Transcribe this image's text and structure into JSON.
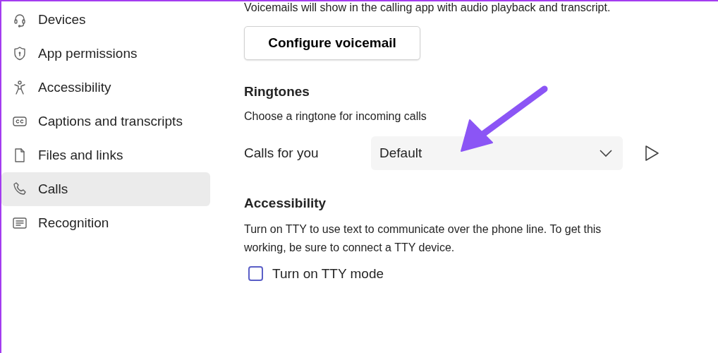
{
  "sidebar": {
    "items": [
      {
        "label": "Devices",
        "kind": "headset",
        "selected": false
      },
      {
        "label": "App permissions",
        "kind": "shield",
        "selected": false
      },
      {
        "label": "Accessibility",
        "kind": "person",
        "selected": false
      },
      {
        "label": "Captions and transcripts",
        "kind": "captions",
        "selected": false
      },
      {
        "label": "Files and links",
        "kind": "file",
        "selected": false
      },
      {
        "label": "Calls",
        "kind": "phone",
        "selected": true
      },
      {
        "label": "Recognition",
        "kind": "textbox",
        "selected": false
      }
    ]
  },
  "voicemail": {
    "description": "Voicemails will show in the calling app with audio playback and transcript.",
    "button": "Configure voicemail"
  },
  "ringtones": {
    "heading": "Ringtones",
    "description": "Choose a ringtone for incoming calls",
    "rows": [
      {
        "label": "Calls for you",
        "value": "Default"
      }
    ]
  },
  "accessibility": {
    "heading": "Accessibility",
    "description": "Turn on TTY to use text to communicate over the phone line. To get this working, be sure to connect a TTY device.",
    "checkbox": {
      "label": "Turn on TTY mode",
      "checked": false
    }
  }
}
